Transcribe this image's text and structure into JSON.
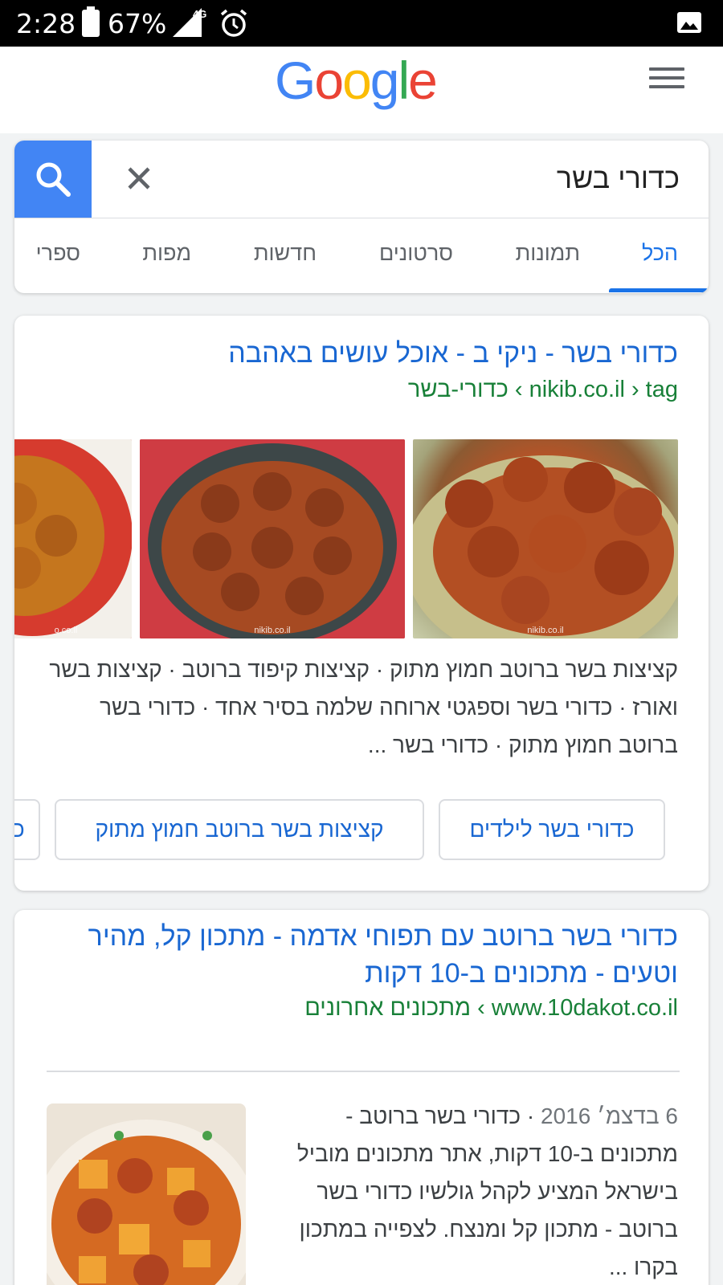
{
  "status_bar": {
    "time": "2:28",
    "battery": "67%",
    "network": "4G",
    "icons": [
      "battery-icon",
      "signal-icon",
      "alarm-icon",
      "photo-icon"
    ]
  },
  "header": {
    "logo_letters": [
      "G",
      "o",
      "o",
      "g",
      "l",
      "e"
    ],
    "logo_colors": [
      "#4285f4",
      "#ea4335",
      "#fbbc05",
      "#4285f4",
      "#34a853",
      "#ea4335"
    ]
  },
  "search": {
    "query": "כדורי בשר",
    "tabs": [
      "הכל",
      "תמונות",
      "סרטונים",
      "חדשות",
      "מפות",
      "ספרי"
    ],
    "active_tab": "הכל"
  },
  "results": [
    {
      "title": "כדורי בשר - ניקי ב - אוכל עושים באהבה",
      "url": "nikib.co.il › tag › כדורי-בשר",
      "image_watermarks": [
        "nikib.co.il",
        "nikib.co.il",
        "o.co.il"
      ],
      "snippet": "קציצות בשר ברוטב חמוץ מתוק · קציצות קיפוד ברוטב · קציצות בשר ואורז · כדורי בשר וספגטי ארוחה שלמה בסיר אחד · כדורי בשר ברוטב חמוץ מתוק · כדורי בשר ...",
      "chips": [
        "כדורי בשר לילדים",
        "קציצות בשר ברוטב חמוץ מתוק",
        "כ"
      ]
    },
    {
      "title": "כדורי בשר ברוטב עם תפוחי אדמה - מתכון קל, מהיר וטעים - מתכונים ב-10 דקות",
      "url": "www.10dakot.co.il › מתכונים אחרונים",
      "date": "6 בדצמ׳ 2016",
      "snippet": "כדורי בשר ברוטב - מתכונים ב-10 דקות, אתר מתכונים מוביל בישראל המציע לקהל גולשיו כדורי בשר ברוטב - מתכון קל ומנצח. לצפייה במתכון בקרו ..."
    }
  ]
}
